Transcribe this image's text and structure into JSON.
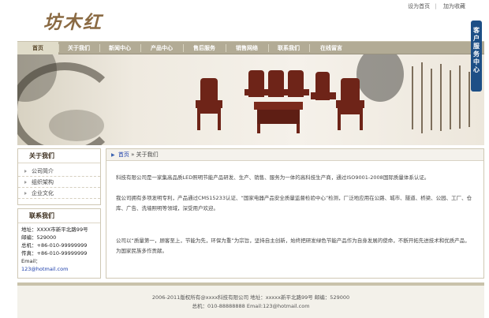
{
  "header": {
    "logo": "坊木红",
    "links": [
      "设为首页",
      "加为收藏"
    ],
    "divider": "|"
  },
  "nav": {
    "items": [
      "首页",
      "关于我们",
      "新闻中心",
      "产品中心",
      "售后服务",
      "销售网络",
      "联系我们",
      "在线留言"
    ]
  },
  "sidetab": {
    "label": "客户服务中心"
  },
  "about_box": {
    "title": "关于我们",
    "items": [
      "公司简介",
      "组织架构",
      "企业文化"
    ]
  },
  "contact_box": {
    "title": "联系我们",
    "address": "地址：XXXX市新平北路99号",
    "zip": "邮编：529000",
    "phone": "总机：+86-010-99999999",
    "fax": "传真：+86-010-99999999",
    "email_label": "Email：",
    "email": "123@hotmail.com"
  },
  "main": {
    "breadcrumb_home": "首页",
    "breadcrumb_sep": "»",
    "breadcrumb_current": "关于我们",
    "paragraphs": [
      "科技有限公司是一家集高品质LED照明节能产品研发、生产、销售、服务为一体的高科技生产商，通过ISO9001-2008国际质量体系认证。",
      "我公司拥有多项发明专利，产品通过CMS15233认证、“国家电器产品安全质量监督检验中心”检测，厂泛地应用在公路、城市、隧道、桥梁、公园、工厂、仓库、广告、洗墙照明等领域，深受用户欢迎。",
      "公司以“质量第一，顾客至上，节能为先，环保为重”为宗旨，坚持自主创新，始终把研发绿色节能产品作为自身发展的使命，不断开拓先进技术和优质产品，为国家民族多作贡献。"
    ]
  },
  "footer": {
    "line1": "2006-2011版权所有@xxxx科技有限公司 地址：xxxxx新平北路99号 邮编：529000",
    "line2": "总机：010-88888888  Email:123@hotmail.com"
  },
  "colors": {
    "nav_bg": "#b2ab95",
    "brand_brown": "#8a6a43",
    "link_blue": "#1a3caa",
    "sidetab_blue": "#1d4f86"
  }
}
